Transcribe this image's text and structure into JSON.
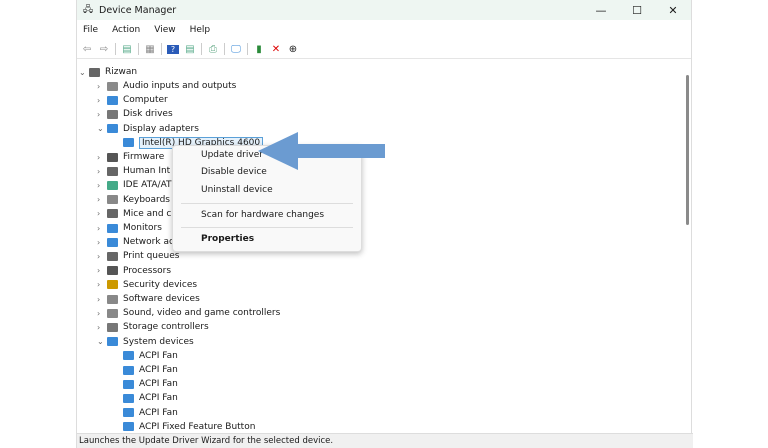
{
  "window": {
    "title": "Device Manager",
    "controls": [
      "minimize",
      "maximize",
      "close"
    ]
  },
  "menubar": [
    "File",
    "Action",
    "View",
    "Help"
  ],
  "toolbar_icons": [
    "back-icon",
    "forward-icon",
    "properties-pane-icon",
    "show-hide-icon",
    "help-icon",
    "action-pane-icon",
    "scan-icon",
    "monitor-icon",
    "enable-device-icon",
    "uninstall-icon",
    "update-driver-icon"
  ],
  "tree": {
    "root": "Rizwan",
    "items": [
      "Audio inputs and outputs",
      "Computer",
      "Disk drives",
      "Display adapters",
      "Intel(R) HD Graphics 4600",
      "Firmware",
      "Human Int",
      "IDE ATA/AT",
      "Keyboards",
      "Mice and c",
      "Monitors",
      "Network ac",
      "Print queues",
      "Processors",
      "Security devices",
      "Software devices",
      "Sound, video and game controllers",
      "Storage controllers",
      "System devices",
      "ACPI Fan",
      "ACPI Fan",
      "ACPI Fan",
      "ACPI Fan",
      "ACPI Fan",
      "ACPI Fixed Feature Button"
    ]
  },
  "context_menu": {
    "items": [
      "Update driver",
      "Disable device",
      "Uninstall device",
      "Scan for hardware changes",
      "Properties"
    ]
  },
  "status_bar": "Launches the Update Driver Wizard for the selected device.",
  "colors": {
    "arrow": "#6b9bd1",
    "selection": "#e5f1fb"
  }
}
